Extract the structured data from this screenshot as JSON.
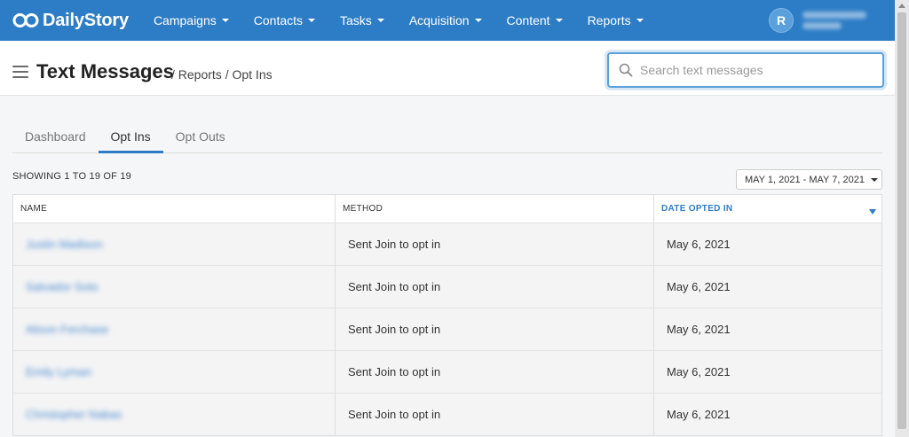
{
  "brand": {
    "name": "DailyStory",
    "accent": "#2d7dc6"
  },
  "nav": [
    {
      "label": "Campaigns"
    },
    {
      "label": "Contacts"
    },
    {
      "label": "Tasks"
    },
    {
      "label": "Acquisition"
    },
    {
      "label": "Content"
    },
    {
      "label": "Reports"
    }
  ],
  "user": {
    "initial": "R"
  },
  "header": {
    "title": "Text Messages",
    "breadcrumb": "/ Reports / Opt Ins",
    "search_placeholder": "Search text messages"
  },
  "tabs": [
    {
      "label": "Dashboard",
      "active": false
    },
    {
      "label": "Opt Ins",
      "active": true
    },
    {
      "label": "Opt Outs",
      "active": false
    }
  ],
  "summary": {
    "showing": "SHOWING 1 TO 19 OF 19"
  },
  "date_filter": {
    "label": "MAY 1, 2021 - MAY 7, 2021"
  },
  "table": {
    "columns": [
      "NAME",
      "METHOD",
      "DATE OPTED IN"
    ],
    "rows": [
      {
        "name": "Justin Madison",
        "method": "Sent Join to opt in",
        "date": "May 6, 2021"
      },
      {
        "name": "Salvador Soto",
        "method": "Sent Join to opt in",
        "date": "May 6, 2021"
      },
      {
        "name": "Alison Ferchase",
        "method": "Sent Join to opt in",
        "date": "May 6, 2021"
      },
      {
        "name": "Emily Lyman",
        "method": "Sent Join to opt in",
        "date": "May 6, 2021"
      },
      {
        "name": "Christopher Nabas",
        "method": "Sent Join to opt in",
        "date": "May 6, 2021"
      }
    ]
  }
}
